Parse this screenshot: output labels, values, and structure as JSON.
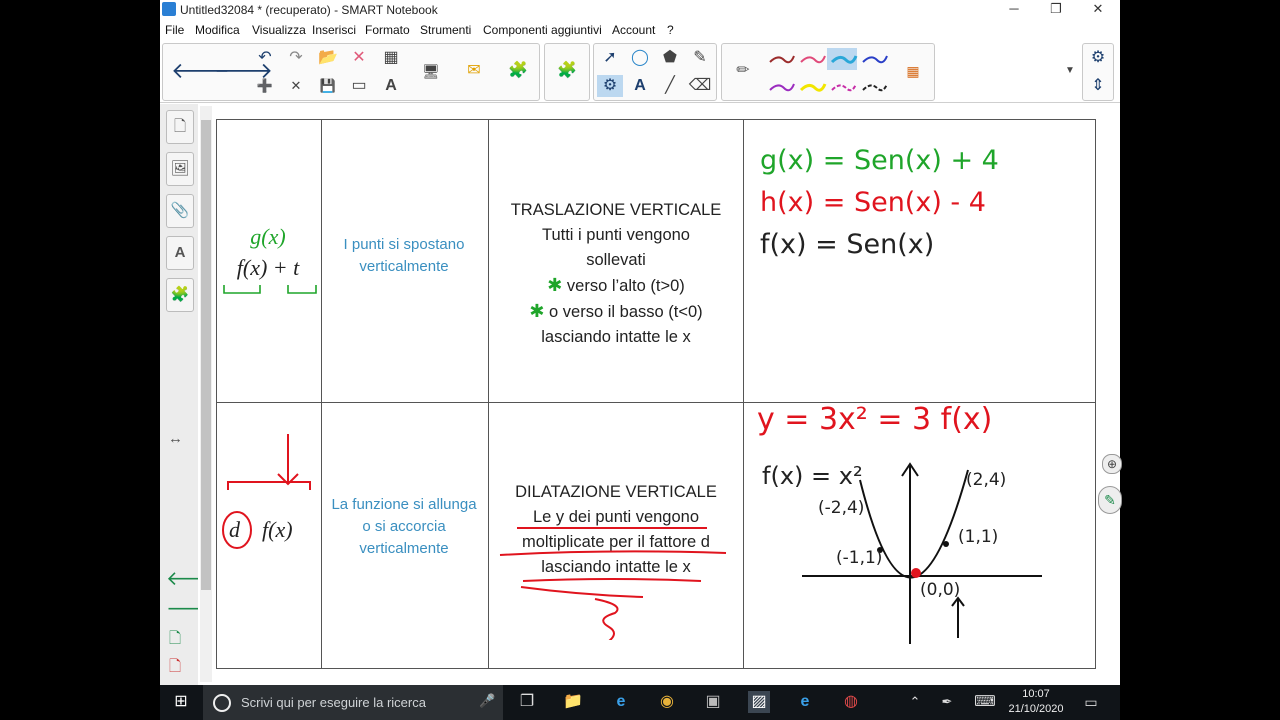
{
  "window": {
    "title": "Untitled32084 * (recuperato) - SMART Notebook",
    "controls": {
      "minimize": "─",
      "maximize": "❐",
      "close": "✕"
    }
  },
  "menu": [
    "File",
    "Modifica",
    "Visualizza",
    "Inserisci",
    "Formato",
    "Strumenti",
    "Componenti aggiuntivi",
    "Account",
    "?"
  ],
  "toolbar": {
    "icons": [
      "back-arrow",
      "forward-arrow",
      "undo",
      "redo",
      "delete",
      "table",
      "open",
      "new-page",
      "save",
      "screen-shade",
      "text-recognition",
      "document-camera",
      "response",
      "add-ons",
      "select",
      "shapes",
      "fill",
      "magic-pen",
      "properties",
      "text",
      "line",
      "eraser",
      "pen"
    ],
    "glyphs": {
      "back": "🡐",
      "forward": "🡒",
      "undo": "↶",
      "redo": "↷",
      "delete": "✕",
      "table": "▦",
      "open": "📂",
      "new": "➕",
      "save": "💾",
      "shade": "▭",
      "text_rec": "A",
      "camera": "🖥",
      "response": "✉",
      "addons": "🧩",
      "puzzle": "🧩",
      "select": "➚",
      "shapes": "◯",
      "fill": "⬟",
      "magic": "✎",
      "props": "⚙",
      "text": "A",
      "line": "╱",
      "eraser": "⌫",
      "pen": "✏",
      "palette": "▦",
      "more": "▼",
      "gear": "⚙",
      "updown": "⇕"
    },
    "pen_colors": [
      "#9b2c2c",
      "#e04a7a",
      "#2aa7d8",
      "#2a3fc7",
      "#9b2cbf",
      "#f2e600",
      "#c72ca7",
      "#222222"
    ]
  },
  "sidebar": {
    "items": [
      {
        "name": "page-sorter",
        "glyph": "🗋"
      },
      {
        "name": "gallery",
        "glyph": "🖼"
      },
      {
        "name": "attachments",
        "glyph": "📎"
      },
      {
        "name": "properties",
        "glyph": "A"
      },
      {
        "name": "add-ons",
        "glyph": "🧩"
      }
    ],
    "toggle_glyph": "↔",
    "bottom": {
      "back": "🡐",
      "forward": "🡒",
      "add_page": "🗋",
      "delete_page": "🗋"
    }
  },
  "table": {
    "row1": {
      "notation_main": "f(x) + t",
      "notation_hand": "g(x)",
      "description": "I punti si spostano verticalmente",
      "explanation": [
        "TRASLAZIONE VERTICALE",
        "Tutti i punti vengono",
        "sollevati",
        "verso l’alto (t>0)",
        "o verso il basso (t<0)",
        "lasciando intatte le x"
      ],
      "examples": [
        "g(x) = Sen(x) + 4",
        "h(x) = Sen(x) - 4",
        "f(x) = Sen(x)"
      ]
    },
    "row2": {
      "notation_main": "f(x)",
      "notation_coef": "d",
      "description": "La funzione si allunga o si accorcia verticalmente",
      "explanation": [
        "DILATAZIONE VERTICALE",
        "Le y dei punti vengono",
        "moltiplicate per il fattore d",
        "lasciando intatte le x"
      ],
      "examples": [
        "y = 3x² = 3 f(x)",
        "f(x) = x²"
      ],
      "graph_points": [
        "(2,4)",
        "(-2,4)",
        "(1,1)",
        "(-1,1)",
        "(0,0)"
      ]
    },
    "asterisk": "✱",
    "colors": {
      "green": "#1fa52a",
      "red": "#e0141e",
      "blue": "#3a8fc0",
      "black": "#222222"
    }
  },
  "right_side": {
    "cursor_glyph": "⊕",
    "pen_glyph": "✎"
  },
  "taskbar": {
    "search_placeholder": "Scrivi qui per eseguire la ricerca",
    "time": "10:07",
    "date": "21/10/2020",
    "icons": [
      "windows",
      "search",
      "mic",
      "task-view",
      "explorer",
      "edge-legacy",
      "chrome",
      "app",
      "smart-notebook",
      "edge",
      "app2",
      "chevron-up",
      "pen",
      "keyboard",
      "notifications"
    ],
    "glyphs": {
      "windows": "⊞",
      "mic": "🎤",
      "taskview": "❐",
      "explorer": "📁",
      "ie": "e",
      "chrome": "◉",
      "app": "▣",
      "notebook": "▨",
      "edge": "e",
      "app2": "◍",
      "chevron": "⌃",
      "pen": "✒",
      "keyboard": "⌨",
      "notif": "▭"
    }
  }
}
